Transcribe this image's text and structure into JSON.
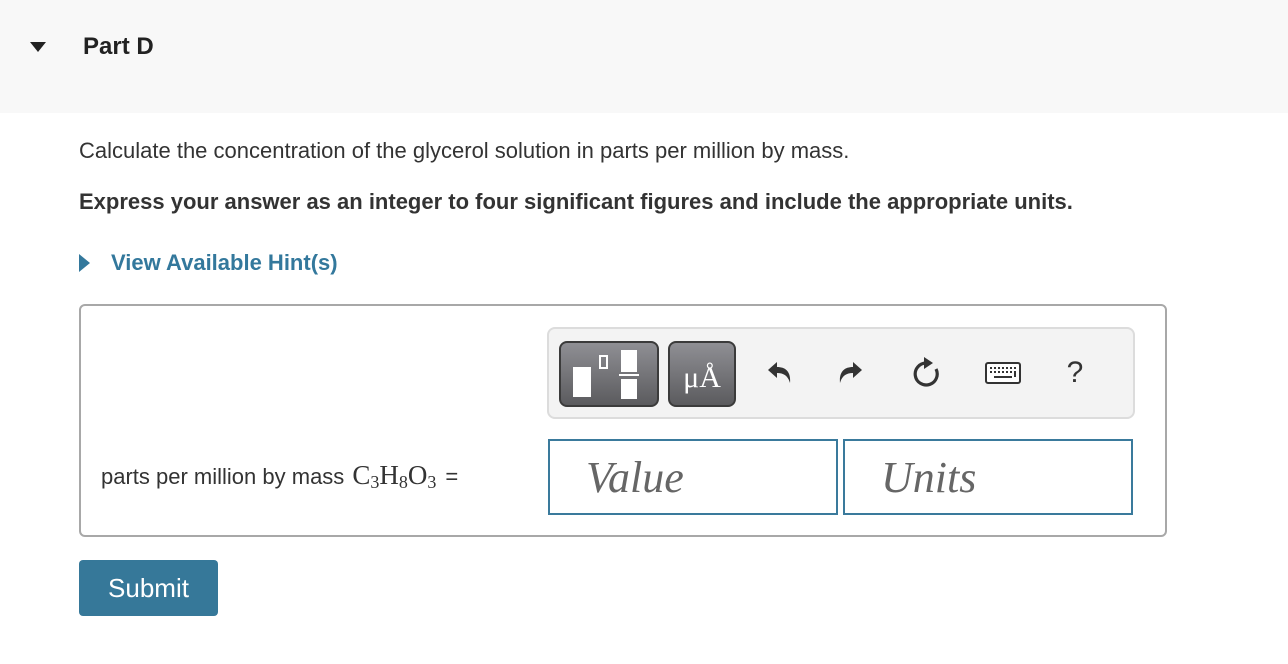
{
  "header": {
    "caret_icon": "caret-down-icon",
    "title": "Part D"
  },
  "question": {
    "text": "Calculate the concentration of the glycerol solution in parts per million by mass.",
    "instruction": "Express your answer as an integer to four significant figures and include the appropriate units."
  },
  "hint": {
    "caret_icon": "caret-right-icon",
    "label": "View Available Hint(s)"
  },
  "toolbar": {
    "buttons": [
      {
        "name": "templates",
        "icon": "fraction-template-icon"
      },
      {
        "name": "symbols",
        "label": "μÅ",
        "icon": "units-symbols-icon"
      },
      {
        "name": "undo",
        "icon": "undo-icon"
      },
      {
        "name": "redo",
        "icon": "redo-icon"
      },
      {
        "name": "reset",
        "icon": "reset-icon"
      },
      {
        "name": "keyboard",
        "icon": "keyboard-icon"
      },
      {
        "name": "help",
        "label": "?",
        "icon": "help-icon"
      }
    ]
  },
  "answer": {
    "label": "parts per million by mass",
    "formula": {
      "parts": [
        {
          "el": "C",
          "sub": "3"
        },
        {
          "el": "H",
          "sub": "8"
        },
        {
          "el": "O",
          "sub": "3"
        }
      ]
    },
    "equals": "=",
    "value_placeholder": "Value",
    "units_placeholder": "Units"
  },
  "submit_label": "Submit",
  "colors": {
    "accent": "#367899",
    "link": "#33789c",
    "field_border": "#3a7a9c",
    "header_bg": "#f8f8f8"
  }
}
